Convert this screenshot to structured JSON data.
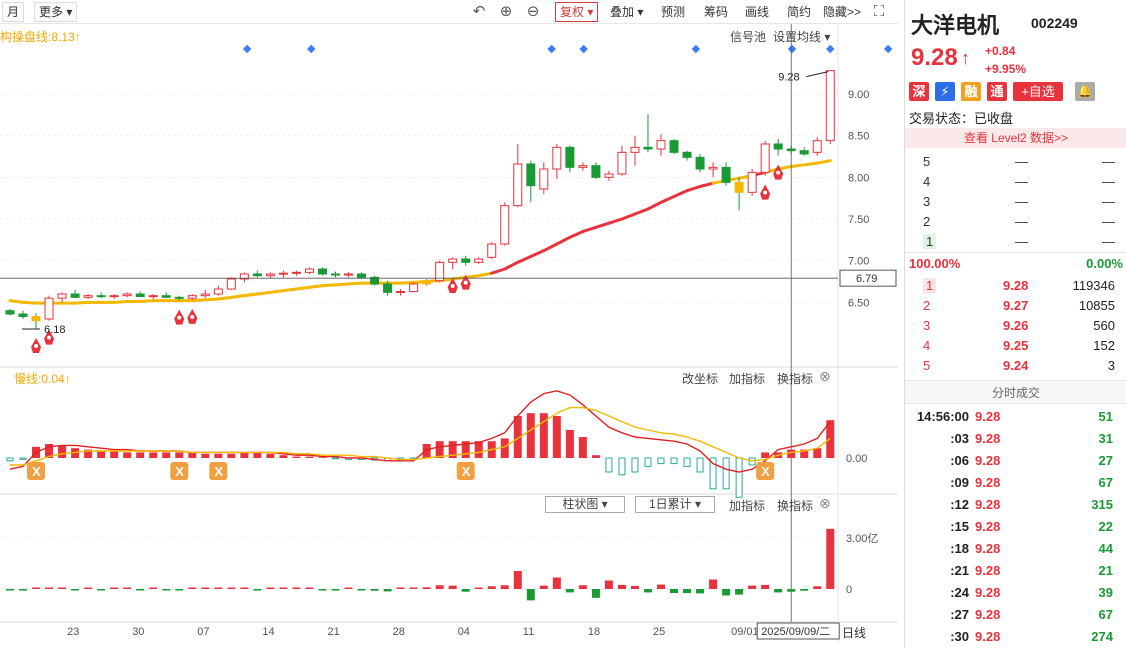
{
  "toolbar": {
    "period": "月",
    "more": "更多",
    "fuquan": "复权",
    "overlay": "叠加",
    "forecast": "预测",
    "fillcode": "筹码",
    "draw": "画线",
    "simple": "简约",
    "hide": "隐藏>>"
  },
  "main_chart": {
    "ma_label": "构操盘线:8.13",
    "signal_pool": "信号池",
    "set_ma": "设置均线",
    "high_label": "9.28",
    "low_label": "6.18",
    "crosshair_price": "6.79",
    "yticks": [
      "9.00",
      "8.50",
      "8.00",
      "7.50",
      "7.00",
      "6.50"
    ]
  },
  "indicator_pane": {
    "label": "慢线:0.04",
    "change_axis": "改坐标",
    "add_indicator": "加指标",
    "switch_indicator": "换指标",
    "zero_label": "0.00"
  },
  "volume_pane": {
    "chart_type": "柱状图",
    "accumulate": "1日累计",
    "add_indicator": "加指标",
    "switch_indicator": "换指标",
    "ytick_top": "3.00亿",
    "ytick_zero": "0"
  },
  "xaxis": {
    "labels": [
      "23",
      "30",
      "07",
      "14",
      "21",
      "28",
      "04",
      "11",
      "18",
      "25",
      "09/01"
    ],
    "crosshair_date": "2025/09/09/二",
    "period_label": "日线"
  },
  "quote": {
    "name": "大洋电机",
    "code": "002249",
    "price": "9.28",
    "change": "+0.84",
    "change_pct": "+9.95%",
    "tags": [
      "深",
      "⚡",
      "融",
      "通"
    ],
    "add_watch": "+自选",
    "status_label": "交易状态：已收盘",
    "level2": "查看 Level2 数据>>",
    "ask_levels": [
      {
        "level": "5",
        "price": "—",
        "vol": "—"
      },
      {
        "level": "4",
        "price": "—",
        "vol": "—"
      },
      {
        "level": "3",
        "price": "—",
        "vol": "—"
      },
      {
        "level": "2",
        "price": "—",
        "vol": "—"
      },
      {
        "level": "1",
        "price": "—",
        "vol": "—"
      }
    ],
    "buy_pct": "100.00%",
    "sell_pct": "0.00%",
    "bid_levels": [
      {
        "level": "1",
        "price": "9.28",
        "vol": "119346"
      },
      {
        "level": "2",
        "price": "9.27",
        "vol": "10855"
      },
      {
        "level": "3",
        "price": "9.26",
        "vol": "560"
      },
      {
        "level": "4",
        "price": "9.25",
        "vol": "152"
      },
      {
        "level": "5",
        "price": "9.24",
        "vol": "3"
      }
    ],
    "ticks_title": "分时成交",
    "ticks": [
      {
        "time": "14:56:00",
        "price": "9.28",
        "vol": "51"
      },
      {
        "time": ":03",
        "price": "9.28",
        "vol": "31"
      },
      {
        "time": ":06",
        "price": "9.28",
        "vol": "27"
      },
      {
        "time": ":09",
        "price": "9.28",
        "vol": "67"
      },
      {
        "time": ":12",
        "price": "9.28",
        "vol": "315"
      },
      {
        "time": ":15",
        "price": "9.28",
        "vol": "22"
      },
      {
        "time": ":18",
        "price": "9.28",
        "vol": "44"
      },
      {
        "time": ":21",
        "price": "9.28",
        "vol": "21"
      },
      {
        "time": ":24",
        "price": "9.28",
        "vol": "39"
      },
      {
        "time": ":27",
        "price": "9.28",
        "vol": "67"
      },
      {
        "time": ":30",
        "price": "9.28",
        "vol": "274"
      }
    ]
  },
  "colors": {
    "up": "#e8323c",
    "down": "#1a9a35",
    "ma": "#f5b800",
    "signal": "#3a7ef5"
  },
  "chart_data": {
    "type": "candlestick",
    "ohlc": [
      [
        6.4,
        6.42,
        6.34,
        6.36
      ],
      [
        6.36,
        6.4,
        6.3,
        6.33
      ],
      [
        6.33,
        6.37,
        6.18,
        6.28
      ],
      [
        6.3,
        6.58,
        6.28,
        6.55
      ],
      [
        6.55,
        6.62,
        6.5,
        6.6
      ],
      [
        6.6,
        6.65,
        6.55,
        6.56
      ],
      [
        6.56,
        6.6,
        6.54,
        6.58
      ],
      [
        6.58,
        6.62,
        6.55,
        6.57
      ],
      [
        6.57,
        6.6,
        6.54,
        6.58
      ],
      [
        6.58,
        6.62,
        6.56,
        6.6
      ],
      [
        6.6,
        6.63,
        6.56,
        6.57
      ],
      [
        6.57,
        6.6,
        6.54,
        6.58
      ],
      [
        6.58,
        6.62,
        6.55,
        6.56
      ],
      [
        6.56,
        6.58,
        6.52,
        6.55
      ],
      [
        6.55,
        6.6,
        6.53,
        6.58
      ],
      [
        6.58,
        6.65,
        6.55,
        6.6
      ],
      [
        6.6,
        6.7,
        6.58,
        6.66
      ],
      [
        6.66,
        6.8,
        6.65,
        6.78
      ],
      [
        6.78,
        6.86,
        6.74,
        6.84
      ],
      [
        6.84,
        6.88,
        6.8,
        6.82
      ],
      [
        6.82,
        6.86,
        6.79,
        6.84
      ],
      [
        6.84,
        6.88,
        6.8,
        6.85
      ],
      [
        6.85,
        6.88,
        6.82,
        6.86
      ],
      [
        6.86,
        6.92,
        6.84,
        6.9
      ],
      [
        6.9,
        6.92,
        6.82,
        6.84
      ],
      [
        6.84,
        6.87,
        6.8,
        6.83
      ],
      [
        6.83,
        6.86,
        6.8,
        6.84
      ],
      [
        6.84,
        6.86,
        6.78,
        6.8
      ],
      [
        6.8,
        6.82,
        6.7,
        6.72
      ],
      [
        6.72,
        6.76,
        6.58,
        6.62
      ],
      [
        6.62,
        6.66,
        6.58,
        6.63
      ],
      [
        6.63,
        6.74,
        6.62,
        6.72
      ],
      [
        6.72,
        6.78,
        6.7,
        6.76
      ],
      [
        6.76,
        7.0,
        6.74,
        6.98
      ],
      [
        6.98,
        7.04,
        6.9,
        7.02
      ],
      [
        7.02,
        7.06,
        6.94,
        6.98
      ],
      [
        6.98,
        7.04,
        6.96,
        7.02
      ],
      [
        7.04,
        7.22,
        7.02,
        7.2
      ],
      [
        7.2,
        7.7,
        7.18,
        7.66
      ],
      [
        7.66,
        8.4,
        7.64,
        8.16
      ],
      [
        8.16,
        8.2,
        7.7,
        7.9
      ],
      [
        7.86,
        8.18,
        7.8,
        8.1
      ],
      [
        8.1,
        8.4,
        7.98,
        8.36
      ],
      [
        8.36,
        8.38,
        8.06,
        8.12
      ],
      [
        8.12,
        8.18,
        8.08,
        8.14
      ],
      [
        8.14,
        8.18,
        7.98,
        8.0
      ],
      [
        8.0,
        8.08,
        7.96,
        8.04
      ],
      [
        8.04,
        8.38,
        8.02,
        8.3
      ],
      [
        8.3,
        8.5,
        8.14,
        8.36
      ],
      [
        8.36,
        8.76,
        8.3,
        8.34
      ],
      [
        8.34,
        8.52,
        8.26,
        8.44
      ],
      [
        8.44,
        8.46,
        8.28,
        8.3
      ],
      [
        8.3,
        8.32,
        8.2,
        8.24
      ],
      [
        8.24,
        8.28,
        8.06,
        8.1
      ],
      [
        8.1,
        8.18,
        8.0,
        8.12
      ],
      [
        8.12,
        8.18,
        7.9,
        7.94
      ],
      [
        7.94,
        8.0,
        7.6,
        7.82
      ],
      [
        7.82,
        8.1,
        7.78,
        8.06
      ],
      [
        8.06,
        8.44,
        8.02,
        8.4
      ],
      [
        8.4,
        8.46,
        8.26,
        8.34
      ],
      [
        8.34,
        8.38,
        8.28,
        8.32
      ],
      [
        8.32,
        8.36,
        8.26,
        8.28
      ],
      [
        8.3,
        8.48,
        8.26,
        8.44
      ],
      [
        8.44,
        9.28,
        8.4,
        9.28
      ]
    ],
    "ma": [
      6.52,
      6.5,
      6.49,
      6.49,
      6.49,
      6.49,
      6.5,
      6.5,
      6.5,
      6.51,
      6.51,
      6.52,
      6.52,
      6.52,
      6.52,
      6.53,
      6.54,
      6.56,
      6.58,
      6.6,
      6.62,
      6.64,
      6.66,
      6.68,
      6.7,
      6.71,
      6.72,
      6.73,
      6.73,
      6.73,
      6.73,
      6.74,
      6.75,
      6.76,
      6.78,
      6.8,
      6.82,
      6.85,
      6.9,
      6.98,
      7.05,
      7.12,
      7.2,
      7.28,
      7.35,
      7.4,
      7.45,
      7.5,
      7.56,
      7.62,
      7.7,
      7.77,
      7.84,
      7.89,
      7.93,
      7.96,
      7.99,
      8.02,
      8.06,
      8.1,
      8.13,
      8.15,
      8.17,
      8.2
    ],
    "macd_hist": [
      -0.02,
      -0.01,
      0.08,
      0.1,
      0.09,
      0.07,
      0.06,
      0.05,
      0.05,
      0.04,
      0.04,
      0.04,
      0.04,
      0.04,
      0.04,
      0.03,
      0.03,
      0.03,
      0.04,
      0.04,
      0.03,
      0.02,
      0.01,
      0.01,
      0.005,
      -0.005,
      -0.01,
      -0.01,
      -0.015,
      -0.02,
      -0.015,
      -0.01,
      0.1,
      0.12,
      0.12,
      0.12,
      0.12,
      0.12,
      0.14,
      0.3,
      0.32,
      0.32,
      0.3,
      0.2,
      0.15,
      0.02,
      -0.1,
      -0.12,
      -0.1,
      -0.06,
      -0.04,
      -0.04,
      -0.06,
      -0.1,
      -0.22,
      -0.22,
      -0.28,
      -0.05,
      0.04,
      0.04,
      0.06,
      0.06,
      0.07,
      0.27
    ],
    "macd_fast": [
      -0.08,
      -0.06,
      0.04,
      0.08,
      0.09,
      0.09,
      0.08,
      0.07,
      0.06,
      0.06,
      0.05,
      0.05,
      0.05,
      0.05,
      0.04,
      0.04,
      0.04,
      0.04,
      0.04,
      0.04,
      0.04,
      0.03,
      0.02,
      0.02,
      0.01,
      0.01,
      0.0,
      0.0,
      -0.01,
      -0.02,
      -0.02,
      -0.02,
      0.06,
      0.08,
      0.09,
      0.1,
      0.11,
      0.14,
      0.18,
      0.3,
      0.4,
      0.46,
      0.48,
      0.45,
      0.38,
      0.3,
      0.22,
      0.18,
      0.15,
      0.14,
      0.13,
      0.12,
      0.1,
      0.05,
      -0.04,
      -0.08,
      -0.1,
      -0.08,
      -0.02,
      0.06,
      0.08,
      0.1,
      0.14,
      0.26
    ],
    "macd_slow": [
      -0.05,
      -0.05,
      -0.02,
      0.01,
      0.03,
      0.04,
      0.05,
      0.05,
      0.05,
      0.05,
      0.05,
      0.05,
      0.05,
      0.05,
      0.04,
      0.04,
      0.04,
      0.04,
      0.04,
      0.04,
      0.04,
      0.04,
      0.03,
      0.03,
      0.02,
      0.02,
      0.02,
      0.01,
      0.01,
      0.0,
      -0.01,
      -0.01,
      0.0,
      0.01,
      0.02,
      0.03,
      0.04,
      0.06,
      0.08,
      0.14,
      0.2,
      0.26,
      0.32,
      0.36,
      0.36,
      0.34,
      0.3,
      0.26,
      0.22,
      0.2,
      0.18,
      0.17,
      0.15,
      0.12,
      0.08,
      0.04,
      0.0,
      -0.02,
      -0.01,
      0.02,
      0.04,
      0.05,
      0.07,
      0.14
    ],
    "volume": [
      0.02,
      0.03,
      0.04,
      0.03,
      0.02,
      0.03,
      0.02,
      0.02,
      0.03,
      0.02,
      0.03,
      0.02,
      0.02,
      0.03,
      0.03,
      0.05,
      0.06,
      0.07,
      0.05,
      0.05,
      0.04,
      0.04,
      0.05,
      0.05,
      0.08,
      0.08,
      0.07,
      0.06,
      0.1,
      0.14,
      0.08,
      0.06,
      0.1,
      0.22,
      0.2,
      0.16,
      0.08,
      0.16,
      0.22,
      1.06,
      0.67,
      0.2,
      0.68,
      0.2,
      0.22,
      0.52,
      0.5,
      0.24,
      0.18,
      0.2,
      0.26,
      0.24,
      0.24,
      0.26,
      0.56,
      0.38,
      0.33,
      0.2,
      0.24,
      0.2,
      0.16,
      0.1,
      0.16,
      3.54
    ],
    "volume_dir": [
      0,
      0,
      1,
      1,
      1,
      0,
      1,
      0,
      1,
      1,
      0,
      1,
      0,
      0,
      1,
      1,
      1,
      1,
      1,
      0,
      1,
      1,
      1,
      1,
      0,
      0,
      1,
      0,
      0,
      0,
      1,
      1,
      1,
      1,
      1,
      0,
      1,
      1,
      1,
      1,
      0,
      1,
      1,
      0,
      1,
      0,
      1,
      1,
      1,
      0,
      1,
      0,
      0,
      0,
      1,
      0,
      0,
      1,
      1,
      0,
      0,
      0,
      1,
      1
    ],
    "ytick_values": [
      9.0,
      8.5,
      8.0,
      7.5,
      7.0,
      6.5
    ],
    "ylim": [
      6.0,
      9.6
    ],
    "crosshair_index": 60,
    "signal_dots": [
      7,
      11,
      26,
      28,
      35,
      41,
      47,
      54
    ]
  }
}
